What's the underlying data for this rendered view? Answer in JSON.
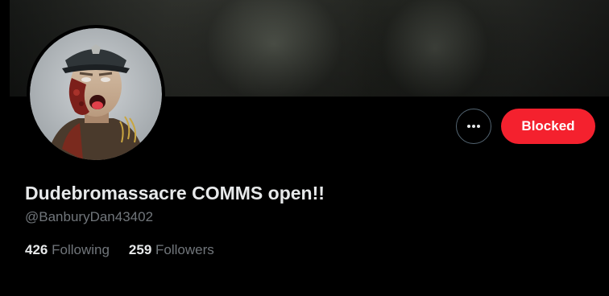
{
  "profile": {
    "display_name": "Dudebromassacre COMMS open!!",
    "handle": "@BanburyDan43402"
  },
  "actions": {
    "more_icon": "more-horizontal-icon",
    "blocked_label": "Blocked"
  },
  "stats": {
    "following_count": "426",
    "following_label": "Following",
    "followers_count": "259",
    "followers_label": "Followers"
  },
  "colors": {
    "background": "#000000",
    "blocked_button": "#f4212e",
    "primary_text": "#e7e9ea",
    "secondary_text": "#71767b",
    "outline": "#536471"
  }
}
